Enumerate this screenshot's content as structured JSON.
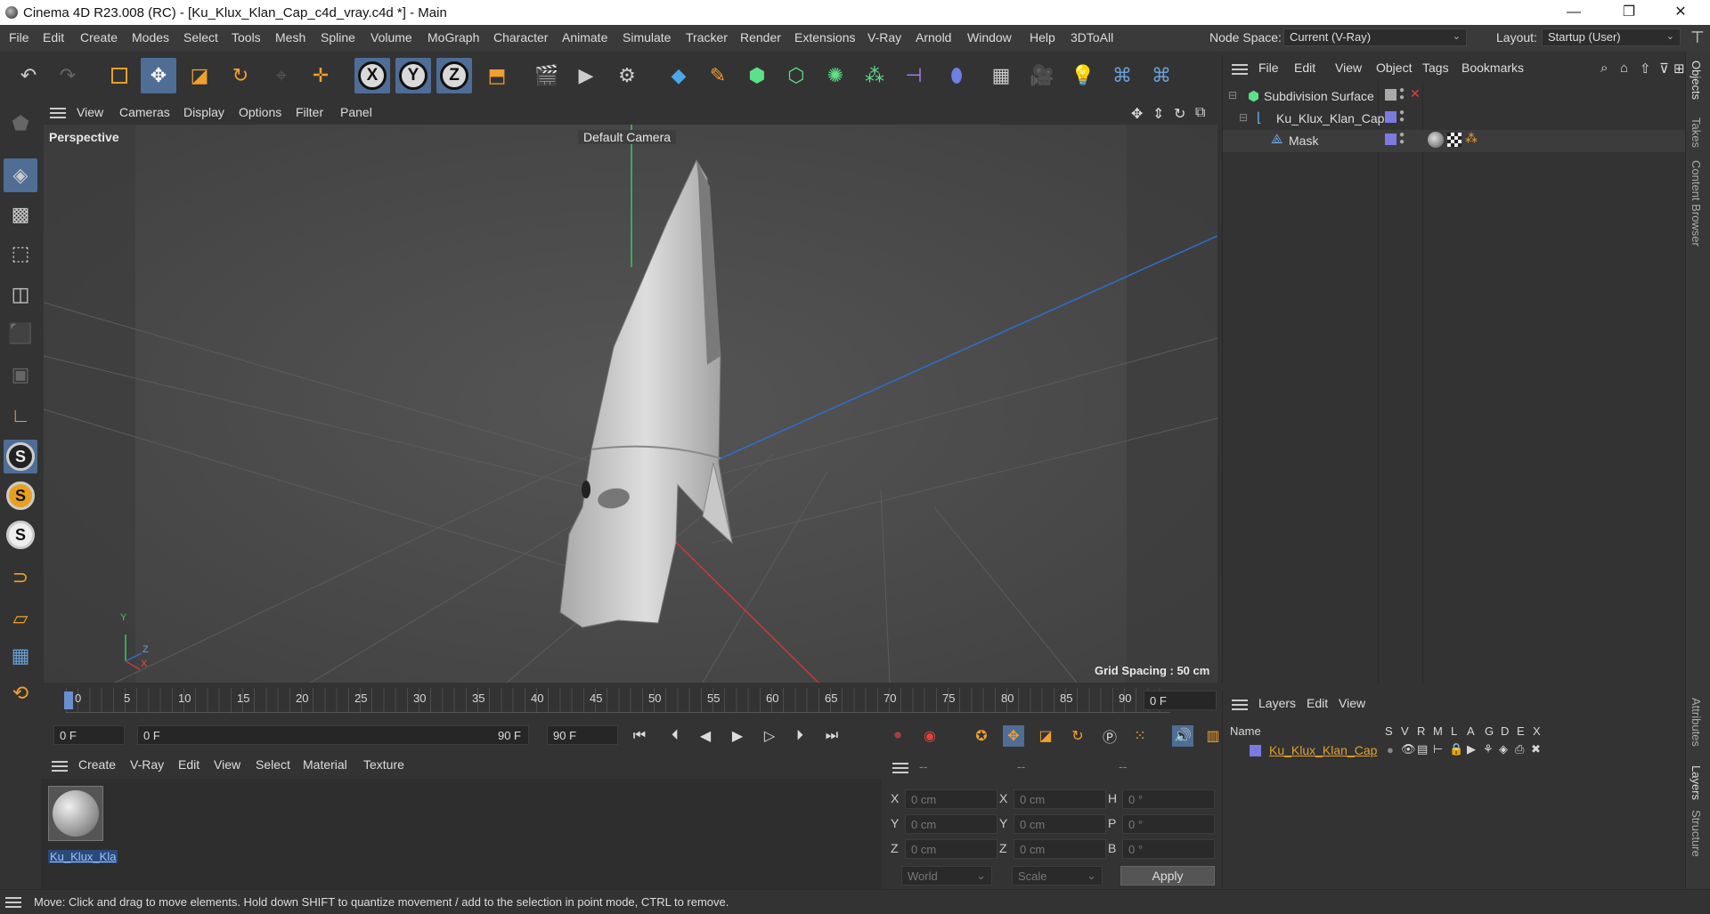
{
  "titlebar": {
    "title": "Cinema 4D R23.008 (RC) - [Ku_Klux_Klan_Cap_c4d_vray.c4d *] - Main",
    "minimize": "—",
    "restore": "❐",
    "close": "✕"
  },
  "menubar": {
    "items": [
      "File",
      "Edit",
      "Create",
      "Modes",
      "Select",
      "Tools",
      "Mesh",
      "Spline",
      "Volume",
      "MoGraph",
      "Character",
      "Animate",
      "Simulate",
      "Tracker",
      "Render",
      "Extensions",
      "V-Ray",
      "Arnold",
      "Window",
      "Help",
      "3DToAll"
    ],
    "node_space_label": "Node Space:",
    "node_space_value": "Current (V-Ray)",
    "layout_label": "Layout:",
    "layout_value": "Startup (User)"
  },
  "viewport": {
    "menu": [
      "View",
      "Cameras",
      "Display",
      "Options",
      "Filter",
      "Panel"
    ],
    "view_name": "Perspective",
    "camera_name": "Default Camera",
    "grid_spacing": "Grid Spacing : 50 cm",
    "axis_labels": {
      "y": "Y",
      "z": "Z",
      "x": "X"
    }
  },
  "timeline": {
    "ticks": [
      "0",
      "5",
      "10",
      "15",
      "20",
      "25",
      "30",
      "35",
      "40",
      "45",
      "50",
      "55",
      "60",
      "65",
      "70",
      "75",
      "80",
      "85",
      "90"
    ],
    "current_frame": "0 F"
  },
  "transport": {
    "start_field": "0 F",
    "range_start": "0 F",
    "range_end": "90 F",
    "end_field": "90 F"
  },
  "material_manager": {
    "menu": [
      "Create",
      "V-Ray",
      "Edit",
      "View",
      "Select",
      "Material",
      "Texture"
    ],
    "material_name": "Ku_Klux_Kla"
  },
  "coordinates": {
    "headers": [
      "--",
      "--",
      "--"
    ],
    "rows": [
      {
        "l1": "X",
        "v1": "0 cm",
        "l2": "X",
        "v2": "0 cm",
        "l3": "H",
        "v3": "0 °"
      },
      {
        "l1": "Y",
        "v1": "0 cm",
        "l2": "Y",
        "v2": "0 cm",
        "l3": "P",
        "v3": "0 °"
      },
      {
        "l1": "Z",
        "v1": "0 cm",
        "l2": "Z",
        "v2": "0 cm",
        "l3": "B",
        "v3": "0 °"
      }
    ],
    "mode_world": "World",
    "mode_scale": "Scale",
    "apply_label": "Apply"
  },
  "object_manager": {
    "menu": [
      "File",
      "Edit",
      "View",
      "Object",
      "Tags",
      "Bookmarks"
    ],
    "objects": [
      {
        "name": "Subdivision Surface"
      },
      {
        "name": "Ku_Klux_Klan_Cap"
      },
      {
        "name": "Mask"
      }
    ]
  },
  "layers": {
    "menu": [
      "Layers",
      "Edit",
      "View"
    ],
    "col_name": "Name",
    "col_flags": [
      "S",
      "V",
      "R",
      "M",
      "L",
      "A",
      "G",
      "D",
      "E",
      "X"
    ],
    "layer_name": "Ku_Klux_Klan_Cap",
    "layer_color": "#7a7ae0"
  },
  "right_tabs": [
    "Objects",
    "Takes",
    "Content Browser",
    "Attributes",
    "Layers",
    "Structure"
  ],
  "status": "Move: Click and drag to move elements. Hold down SHIFT to quantize movement / add to the selection in point mode, CTRL to remove.",
  "colors": {
    "accent": "#4f6d95",
    "layer_text": "#e0a030",
    "selection": "#5a5a5a"
  },
  "icons": [
    "undo-icon",
    "redo-icon",
    "live-selection-icon",
    "move-icon",
    "scale-icon",
    "rotate-icon",
    "x-axis-icon",
    "y-axis-icon",
    "z-axis-icon",
    "coord-system-icon",
    "render-view-icon",
    "render-icon",
    "render-settings-icon",
    "cube-icon",
    "pen-icon",
    "subdivision-icon",
    "extrude-icon",
    "cloner-icon",
    "array-icon",
    "deformer-icon",
    "field-icon",
    "floor-icon",
    "camera-icon",
    "light-icon",
    "python-icon"
  ]
}
